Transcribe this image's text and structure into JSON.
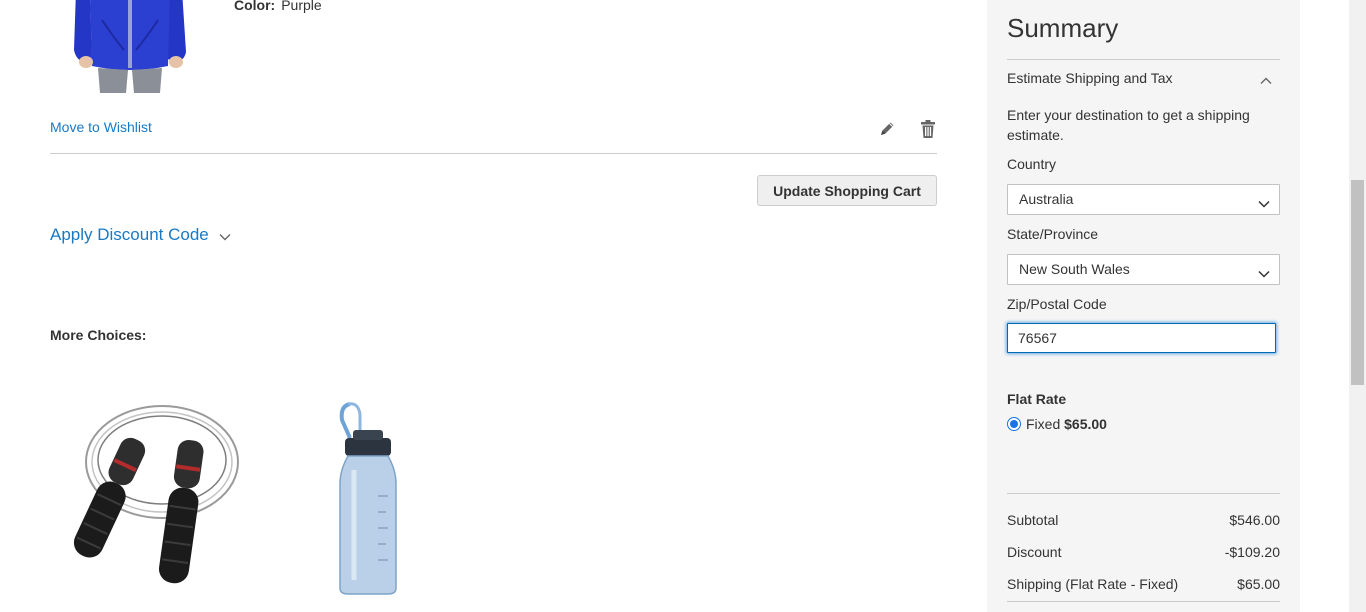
{
  "cart_item": {
    "color_label": "Color:",
    "color_value": "Purple",
    "wishlist_link": "Move to Wishlist",
    "edit_icon": "pencil-icon",
    "delete_icon": "trash-icon"
  },
  "cart_actions": {
    "update_button": "Update Shopping Cart"
  },
  "discount": {
    "toggle_label": "Apply Discount Code"
  },
  "crosssell": {
    "heading": "More Choices:"
  },
  "summary": {
    "title": "Summary",
    "shipping_toggle": "Estimate Shipping and Tax",
    "hint": "Enter your destination to get a shipping estimate.",
    "country_label": "Country",
    "country_value": "Australia",
    "state_label": "State/Province",
    "state_value": "New South Wales",
    "zip_label": "Zip/Postal Code",
    "zip_value": "76567",
    "flat_rate_title": "Flat Rate",
    "flat_rate_option": "Fixed",
    "flat_rate_price": "$65.00",
    "totals": [
      {
        "label": "Subtotal",
        "amount": "$546.00"
      },
      {
        "label": "Discount",
        "amount": "-$109.20"
      },
      {
        "label": "Shipping (Flat Rate - Fixed)",
        "amount": "$65.00"
      }
    ]
  },
  "colors": {
    "link": "#1979c3",
    "panel_bg": "#f5f5f5",
    "focus_border": "#006bb4",
    "jacket": "#2b3fd0"
  }
}
